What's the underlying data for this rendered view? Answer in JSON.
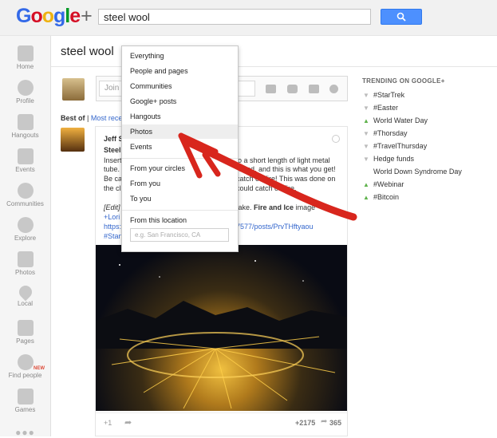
{
  "header": {
    "logo_parts": [
      "G",
      "o",
      "o",
      "g",
      "l",
      "e",
      "+"
    ],
    "search_value": "steel wool"
  },
  "nav": [
    {
      "label": "Home"
    },
    {
      "label": "Profile"
    },
    {
      "label": "Hangouts"
    },
    {
      "label": "Events"
    },
    {
      "label": "Communities"
    },
    {
      "label": "Explore"
    },
    {
      "label": "Photos"
    },
    {
      "label": "Local"
    },
    {
      "label": "Pages"
    },
    {
      "label": "Find people",
      "badge": "NEW"
    },
    {
      "label": "Games"
    }
  ],
  "page_title": "steel wool",
  "share": {
    "placeholder": "Join t"
  },
  "filter": {
    "label": "Best of",
    "sep": "|",
    "most_recent": "Most recen"
  },
  "dropdown": {
    "items": [
      "Everything",
      "People and pages",
      "Communities",
      "Google+ posts",
      "Hangouts",
      "Photos",
      "Events"
    ],
    "circle_items": [
      "From your circles",
      "From you",
      "To you"
    ],
    "location_label": "From this location",
    "location_placeholder": "e.g. San Francisco, CA",
    "highlighted": "Photos"
  },
  "post": {
    "author": "Jeff S",
    "line1": "Steel",
    "line2a": "Insert",
    "line2b": "o a short length of light metal",
    "line3a": "tube.",
    "line3b": "round, and this is what you get!",
    "line4a": " Be ca",
    "line4b": "catch on fire!  This was done on",
    "line5a": "the cl",
    "line5b": "could catch on fire.",
    "edit_a": "[Edit]",
    "edit_b": "on lake.",
    "edit_bold": "Fire and Ice",
    "edit_c": "image",
    "mention": "+Lori",
    "link_a": "https:",
    "link_b": "7577/posts/PrvTHftyaou",
    "hashtag": "#Stan",
    "plus_one": "+1",
    "plus_count": "+2175",
    "share_count": "365"
  },
  "trending": {
    "title": "TRENDING ON GOOGLE+",
    "items": [
      {
        "text": "#StarTrek",
        "dir": "down"
      },
      {
        "text": "#Easter",
        "dir": "down"
      },
      {
        "text": "World Water Day",
        "dir": "up"
      },
      {
        "text": "#Thorsday",
        "dir": "down"
      },
      {
        "text": "#TravelThursday",
        "dir": "down"
      },
      {
        "text": "Hedge funds",
        "dir": "down"
      },
      {
        "text": "World Down Syndrome Day",
        "dir": "none"
      },
      {
        "text": "#Webinar",
        "dir": "up"
      },
      {
        "text": "#Bitcoin",
        "dir": "up"
      }
    ]
  },
  "colors": {
    "accent": "#4d90fe",
    "annotation_red": "#d8261d"
  }
}
